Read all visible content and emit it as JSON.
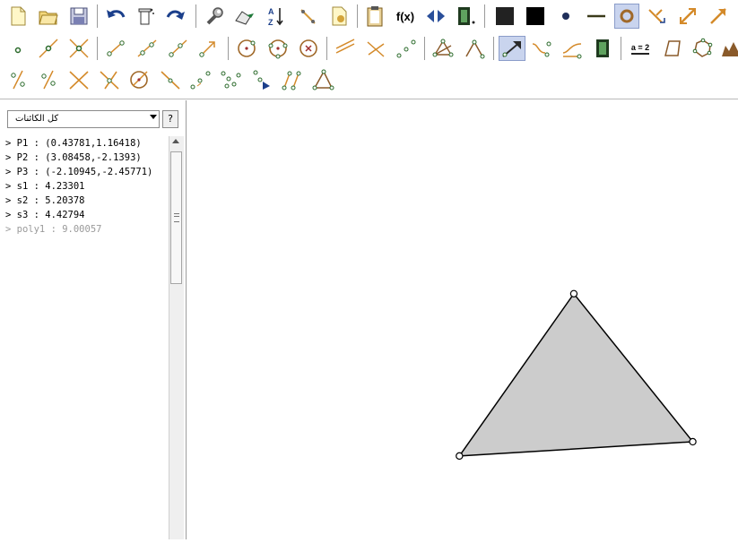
{
  "toolbar": {
    "row1": [
      "new-file-icon",
      "open-file-icon",
      "save-icon",
      "undo-icon",
      "delete-icon",
      "redo-icon",
      "properties-wrench-icon",
      "copy-style-icon",
      "sort-az-icon",
      "record-icon",
      "export-icon",
      "clipboard-icon",
      "function-fx-icon",
      "slide-arrows-icon",
      "film-icon",
      "black-square-icon",
      "filled-square-icon",
      "point-dot-icon",
      "line-dash-icon",
      "circle-toggle-icon",
      "intersect-arrows-icon",
      "arrow-diagonal-icon",
      "vector-icon"
    ],
    "fx_label": "f(x)",
    "row2": [
      "point-icon",
      "point-on-line-icon",
      "intersection-icon",
      "segment-icon",
      "line-icon",
      "ray-icon",
      "vector-tool-icon",
      "circle-center-icon",
      "circle-three-point-icon",
      "circle-radius-icon",
      "perpendicular-icon",
      "parallel-icon",
      "midpoint-icon",
      "polygon-icon",
      "angle-icon",
      "move-tool-icon",
      "curve-icon",
      "locus-icon",
      "slider-film-icon",
      "equation-icon",
      "regular-polygon-icon",
      "polyline-icon",
      "brush-icon"
    ],
    "equation_label": "a = 2",
    "row3": [
      "reflect-line-icon",
      "reflect-point-icon",
      "rotate-icon",
      "dilate-icon",
      "circle-arc-icon",
      "tangent-icon",
      "sequence-icon",
      "locus-points-icon",
      "graph-icon",
      "conic-icon",
      "triangle-icon"
    ]
  },
  "sidebar": {
    "selector_value": "كل الكائنات",
    "help_label": "?",
    "objects": [
      {
        "text": "> P1 : (0.43781,1.16418)",
        "aux": false
      },
      {
        "text": "> P2 : (3.08458,-2.1393)",
        "aux": false
      },
      {
        "text": "> P3 : (-2.10945,-2.45771)",
        "aux": false
      },
      {
        "text": "> s1 : 4.23301",
        "aux": false
      },
      {
        "text": "> s2 : 5.20378",
        "aux": false
      },
      {
        "text": "> s3 : 4.42794",
        "aux": false
      },
      {
        "text": "> poly1 : 9.00057",
        "aux": true
      }
    ]
  },
  "canvas": {
    "polygon_fill": "#cccccc",
    "polygon_stroke": "#000000",
    "points": [
      {
        "name": "P1",
        "x": 0.43781,
        "y": 1.16418
      },
      {
        "name": "P2",
        "x": 3.08458,
        "y": -2.1393
      },
      {
        "name": "P3",
        "x": -2.10945,
        "y": -2.45771
      }
    ]
  }
}
